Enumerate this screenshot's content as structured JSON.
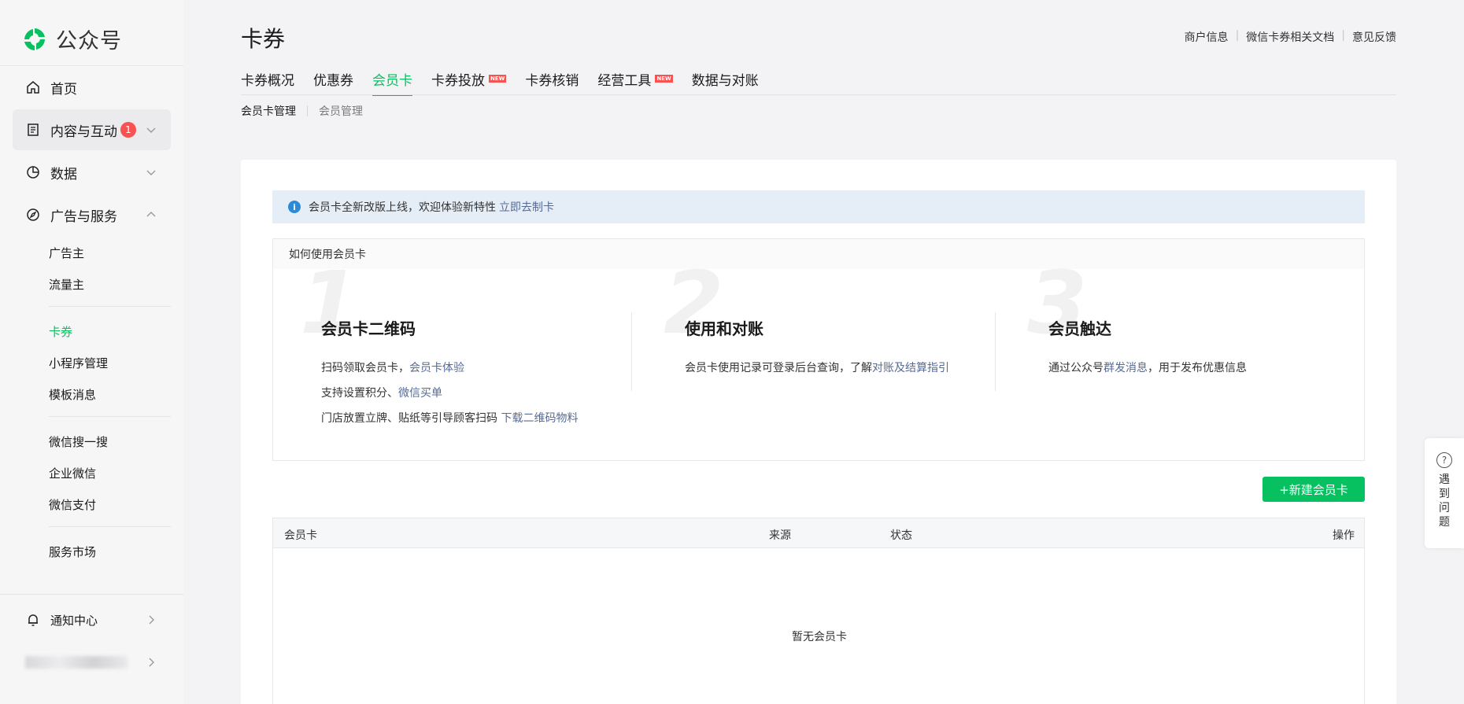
{
  "brand": {
    "name": "公众号",
    "color": "#07c160"
  },
  "sidebar": {
    "items": [
      {
        "label": "首页",
        "icon": "home-icon"
      },
      {
        "label": "内容与互动",
        "icon": "document-icon",
        "badge": "1"
      },
      {
        "label": "数据",
        "icon": "pie-chart-icon"
      },
      {
        "label": "广告与服务",
        "icon": "compass-icon"
      }
    ],
    "sub_items": [
      {
        "label": "广告主"
      },
      {
        "label": "流量主"
      },
      {
        "label": "卡券"
      },
      {
        "label": "小程序管理"
      },
      {
        "label": "模板消息"
      },
      {
        "label": "微信搜一搜"
      },
      {
        "label": "企业微信"
      },
      {
        "label": "微信支付"
      },
      {
        "label": "服务市场"
      }
    ],
    "notification": "通知中心"
  },
  "header": {
    "title": "卡券",
    "links": [
      "商户信息",
      "微信卡券相关文档",
      "意见反馈"
    ]
  },
  "tabs": [
    {
      "label": "卡券概况"
    },
    {
      "label": "优惠券"
    },
    {
      "label": "会员卡"
    },
    {
      "label": "卡券投放",
      "tag": "NEW"
    },
    {
      "label": "卡券核销"
    },
    {
      "label": "经营工具",
      "tag": "NEW"
    },
    {
      "label": "数据与对账"
    }
  ],
  "subtabs": [
    "会员卡管理",
    "会员管理"
  ],
  "notice": {
    "text": "会员卡全新改版上线，欢迎体验新特性",
    "link": "立即去制卡"
  },
  "howto": {
    "title": "如何使用会员卡",
    "steps": [
      {
        "num": "1",
        "title": "会员卡二维码",
        "lines": [
          {
            "text": "扫码领取会员卡，",
            "link": "会员卡体验"
          },
          {
            "text": "支持设置积分、",
            "link": "微信买单"
          },
          {
            "text": "门店放置立牌、贴纸等引导顾客扫码 ",
            "link": "下载二维码物料"
          }
        ]
      },
      {
        "num": "2",
        "title": "使用和对账",
        "lines": [
          {
            "text": "会员卡使用记录可登录后台查询，了解",
            "link": "对账及结算指引"
          }
        ]
      },
      {
        "num": "3",
        "title": "会员触达",
        "lines": [
          {
            "text": "通过公众号",
            "link": "群发消息",
            "suffix": "，用于发布优惠信息"
          }
        ]
      }
    ]
  },
  "new_button": "+新建会员卡",
  "table": {
    "columns": [
      "会员卡",
      "来源",
      "状态",
      "操作"
    ],
    "empty": "暂无会员卡"
  },
  "help": {
    "icon": "?",
    "text": "遇到问题"
  }
}
